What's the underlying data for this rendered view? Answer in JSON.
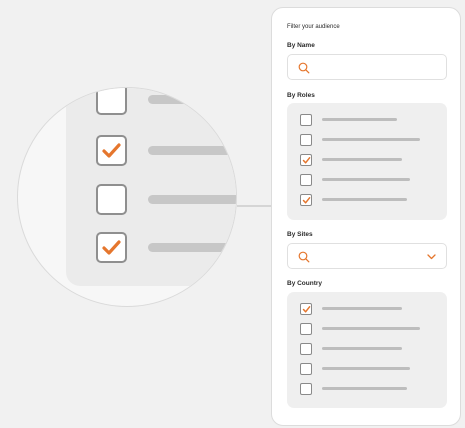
{
  "accent_color": "#e5762d",
  "magnifier": {
    "items": [
      {
        "checked": false
      },
      {
        "checked": true
      },
      {
        "checked": false
      },
      {
        "checked": true
      }
    ]
  },
  "card": {
    "title": "Filter your audience",
    "by_name": {
      "label": "By Name",
      "value": "",
      "icon": "search-icon"
    },
    "by_roles": {
      "label": "By Roles",
      "items": [
        {
          "checked": false
        },
        {
          "checked": false
        },
        {
          "checked": true
        },
        {
          "checked": false
        },
        {
          "checked": true
        }
      ]
    },
    "by_sites": {
      "label": "By Sites",
      "value": "",
      "icon": "search-icon",
      "dropdown_icon": "chevron-down-icon"
    },
    "by_country": {
      "label": "By Country",
      "items": [
        {
          "checked": true
        },
        {
          "checked": false
        },
        {
          "checked": false
        },
        {
          "checked": false
        },
        {
          "checked": false
        }
      ]
    }
  }
}
